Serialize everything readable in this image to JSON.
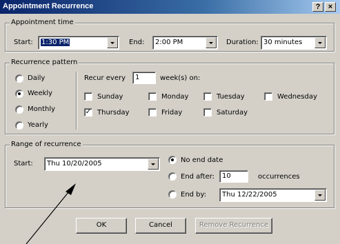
{
  "window": {
    "title": "Appointment Recurrence",
    "help_btn": "?",
    "close_btn": "×"
  },
  "appointment_time": {
    "legend": "Appointment time",
    "start_label": "Start:",
    "start_value": "1:30 PM",
    "end_label": "End:",
    "end_value": "2:00 PM",
    "duration_label": "Duration:",
    "duration_value": "30 minutes"
  },
  "recurrence_pattern": {
    "legend": "Recurrence pattern",
    "frequencies": [
      {
        "label": "Daily",
        "selected": false
      },
      {
        "label": "Weekly",
        "selected": true
      },
      {
        "label": "Monthly",
        "selected": false
      },
      {
        "label": "Yearly",
        "selected": false
      }
    ],
    "recur_every_label": "Recur every",
    "recur_every_value": "1",
    "weeks_on_label": "week(s) on:",
    "days": [
      {
        "label": "Sunday",
        "checked": false
      },
      {
        "label": "Monday",
        "checked": false
      },
      {
        "label": "Tuesday",
        "checked": false
      },
      {
        "label": "Wednesday",
        "checked": false
      },
      {
        "label": "Thursday",
        "checked": true
      },
      {
        "label": "Friday",
        "checked": false
      },
      {
        "label": "Saturday",
        "checked": false
      }
    ]
  },
  "range": {
    "legend": "Range of recurrence",
    "start_label": "Start:",
    "start_value": "Thu 10/20/2005",
    "no_end_label": "No end date",
    "end_after_label": "End after:",
    "end_after_value": "10",
    "occurrences_label": "occurrences",
    "end_by_label": "End by:",
    "end_by_value": "Thu 12/22/2005",
    "selected": "no_end"
  },
  "buttons": {
    "ok": "OK",
    "cancel": "Cancel",
    "remove": "Remove Recurrence"
  },
  "colors": {
    "title_start": "#0a246a",
    "title_end": "#a6caf0",
    "face": "#d4d0c8",
    "selection": "#0a246a"
  }
}
